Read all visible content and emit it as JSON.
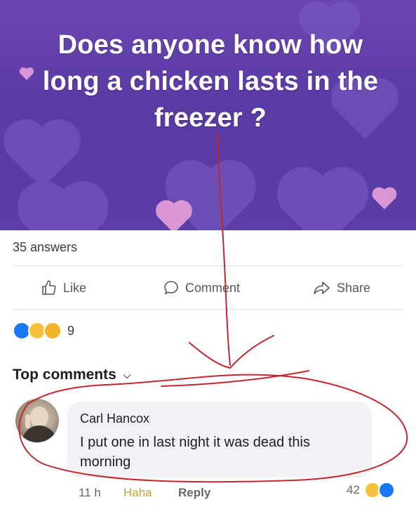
{
  "post": {
    "title": "Does anyone know how long a chicken lasts in the freezer ?",
    "answers": "35 answers"
  },
  "actions": {
    "like": "Like",
    "comment": "Comment",
    "share": "Share"
  },
  "reactions": {
    "count": "9",
    "icons": [
      "like-icon",
      "haha-icon",
      "wow-icon"
    ]
  },
  "top_comments": {
    "label": "Top comments"
  },
  "comment": {
    "author": "Carl Hancox",
    "text": "I put one in last night it was dead this morning",
    "time": "11 h",
    "reaction_label": "Haha",
    "reply_label": "Reply",
    "reaction_count": "42"
  },
  "colors": {
    "banner": "#5b3aa3",
    "annotation": "#c1272d",
    "like_blue": "#1877f2"
  }
}
